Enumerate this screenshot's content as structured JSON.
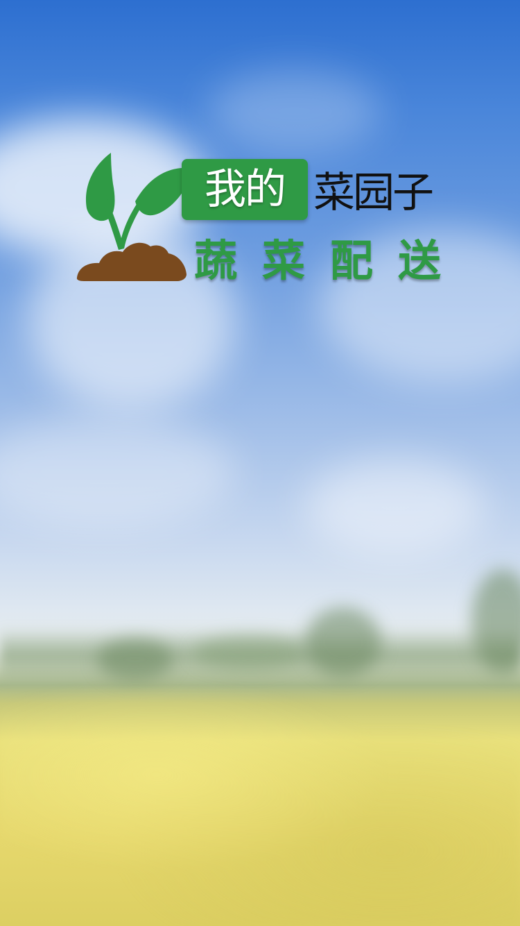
{
  "splash": {
    "title_highlight": "我的",
    "title_rest": "菜园子",
    "subtitle": "蔬菜配送"
  },
  "colors": {
    "brand_green": "#2f9a45",
    "soil_brown": "#7a4a1e",
    "title_dark": "#111111",
    "sky_blue": "#2d6fd0",
    "field_yellow": "#e6d86d"
  },
  "icons": {
    "logo": "sprout-in-soil-logo"
  }
}
